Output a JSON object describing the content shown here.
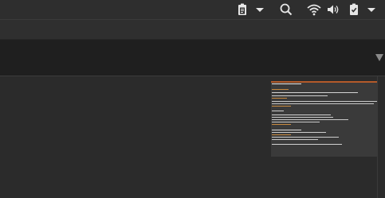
{
  "top_panel": {
    "icons": [
      {
        "name": "clipboard-icon"
      },
      {
        "name": "dropdown-arrow-icon"
      },
      {
        "name": "search-icon"
      },
      {
        "name": "wifi-icon"
      },
      {
        "name": "volume-icon"
      },
      {
        "name": "clipboard-check-icon"
      },
      {
        "name": "menu-dropdown-icon"
      }
    ]
  },
  "colors": {
    "panel_bg": "#2e2e2e",
    "content_bg": "#2b2b2b",
    "header_band_bg": "#1f1f1f",
    "icon_color": "#e6e6e6",
    "minimap_bg": "#3a3a3a",
    "minimap_accent": "#b35a2a"
  }
}
